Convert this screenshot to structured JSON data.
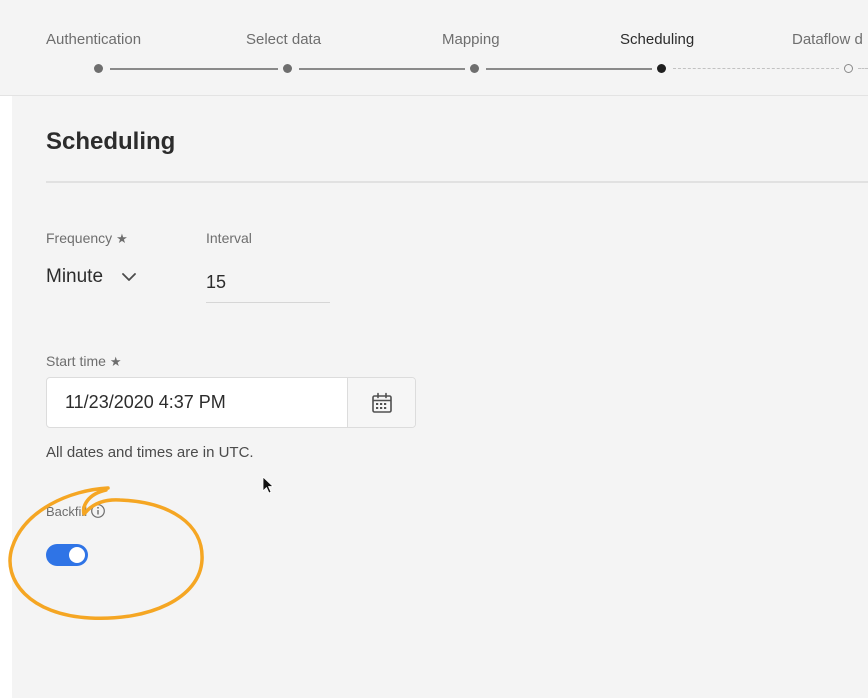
{
  "stepper": {
    "steps": [
      {
        "label": "Authentication",
        "state": "completed"
      },
      {
        "label": "Select data",
        "state": "completed"
      },
      {
        "label": "Mapping",
        "state": "completed"
      },
      {
        "label": "Scheduling",
        "state": "active"
      },
      {
        "label": "Dataflow d",
        "state": "upcoming"
      }
    ]
  },
  "page": {
    "title": "Scheduling"
  },
  "form": {
    "frequency": {
      "label": "Frequency",
      "required_mark": "★",
      "value": "Minute"
    },
    "interval": {
      "label": "Interval",
      "value": "15"
    },
    "start_time": {
      "label": "Start time",
      "required_mark": "★",
      "value": "11/23/2020 4:37 PM"
    },
    "timezone_note": "All dates and times are in UTC.",
    "backfill": {
      "label": "Backfill",
      "enabled": true
    }
  },
  "colors": {
    "toggle_on": "#2f74e6",
    "annotation": "#f5a623"
  },
  "icons": {
    "frequency_dropdown": "chevron-down-icon",
    "date_picker": "calendar-icon",
    "backfill_help": "info-icon"
  }
}
